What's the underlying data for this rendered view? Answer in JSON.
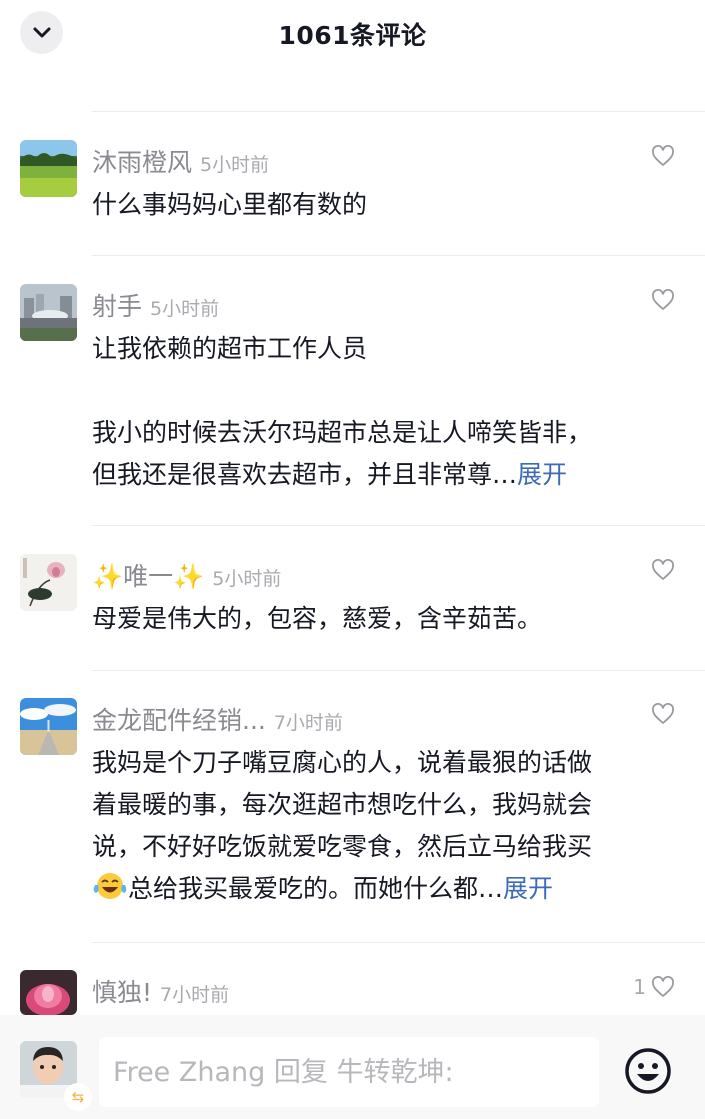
{
  "header": {
    "title": "1061条评论",
    "collapse_icon": "chevron-down-icon"
  },
  "comments": [
    {
      "username": "沐雨橙风",
      "time": "5小时前",
      "lines": [
        "什么事妈妈心里都有数的"
      ],
      "expand": "",
      "likes": "",
      "avatar": "landscape"
    },
    {
      "username": "射手",
      "time": "5小时前",
      "lines": [
        "让我依赖的超市工作人员",
        "",
        "我小的时候去沃尔玛超市总是让人啼笑皆非，",
        "但我还是很喜欢去超市，并且非常尊…"
      ],
      "expand": "展开",
      "likes": "",
      "avatar": "city"
    },
    {
      "username": "✨唯一✨",
      "time": "5小时前",
      "lines": [
        "母爱是伟大的，包容，慈爱，含辛茹苦。"
      ],
      "expand": "",
      "likes": "",
      "avatar": "lotus-painting"
    },
    {
      "username": "金龙配件经销...",
      "time": "7小时前",
      "lines": [
        "我妈是个刀子嘴豆腐心的人，说着最狠的话做",
        "着最暖的事，每次逛超市想吃什么，我妈就会",
        "说，不好好吃饭就爱吃零食，然后立马给我买",
        "总给我买最爱吃的。而她什么都…"
      ],
      "expand": "展开",
      "likes": "",
      "avatar": "sky-road"
    },
    {
      "username": "慎独!",
      "time": "7小时前",
      "lines": [],
      "expand": "",
      "likes": "1",
      "avatar": "lotus-flower"
    }
  ],
  "reply_bar": {
    "placeholder": "Free Zhang 回复 牛转乾坤:",
    "swap_glyph": "⇆",
    "emoji_icon": "smiley-face-icon"
  },
  "colors": {
    "expand_link": "#3d6ab5",
    "username": "#8a8b91",
    "timestamp": "#a9aab0"
  }
}
